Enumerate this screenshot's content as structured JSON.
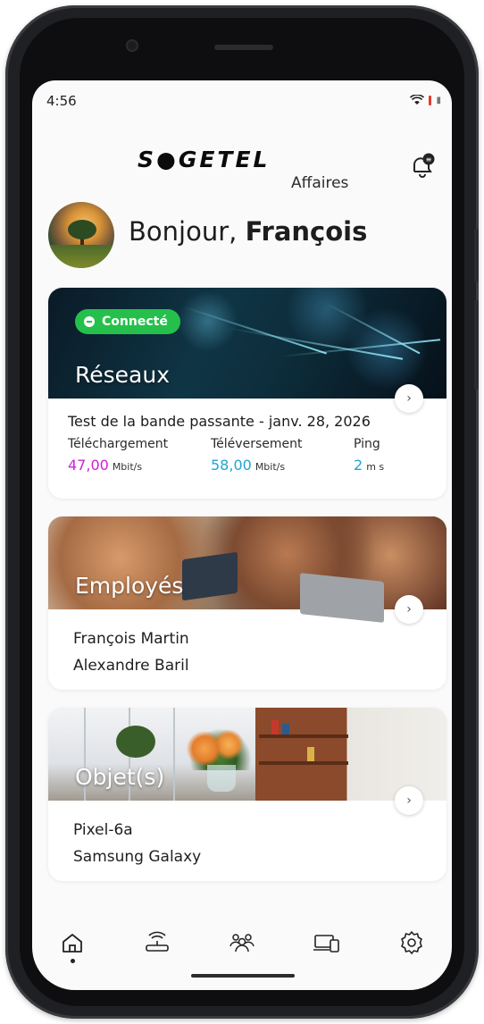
{
  "status_bar": {
    "time": "4:56"
  },
  "header": {
    "brand": "S●GETEL",
    "brand_sub": "Affaires"
  },
  "greeting": {
    "prefix": "Bonjour,",
    "name": "François"
  },
  "network_card": {
    "badge": "Connecté",
    "title": "Réseaux",
    "test_line": "Test de la bande passante - janv. 28, 2026",
    "download": {
      "label": "Téléchargement",
      "value": "47,00",
      "unit": "Mbit/s",
      "color": "#d21fd9"
    },
    "upload": {
      "label": "Téléversement",
      "value": "58,00",
      "unit": "Mbit/s",
      "color": "#1fa6d2"
    },
    "ping": {
      "label": "Ping",
      "value": "2",
      "unit": "m s",
      "color": "#1fa6d2"
    }
  },
  "employees_card": {
    "title": "Employés",
    "items": [
      "François Martin",
      "Alexandre Baril"
    ]
  },
  "objects_card": {
    "title": "Objet(s)",
    "items": [
      "Pixel-6a",
      "Samsung Galaxy"
    ]
  },
  "bottom_nav": [
    {
      "icon": "home-icon",
      "active": true
    },
    {
      "icon": "router-icon",
      "active": false
    },
    {
      "icon": "users-icon",
      "active": false
    },
    {
      "icon": "devices-icon",
      "active": false
    },
    {
      "icon": "settings-icon",
      "active": false
    }
  ]
}
